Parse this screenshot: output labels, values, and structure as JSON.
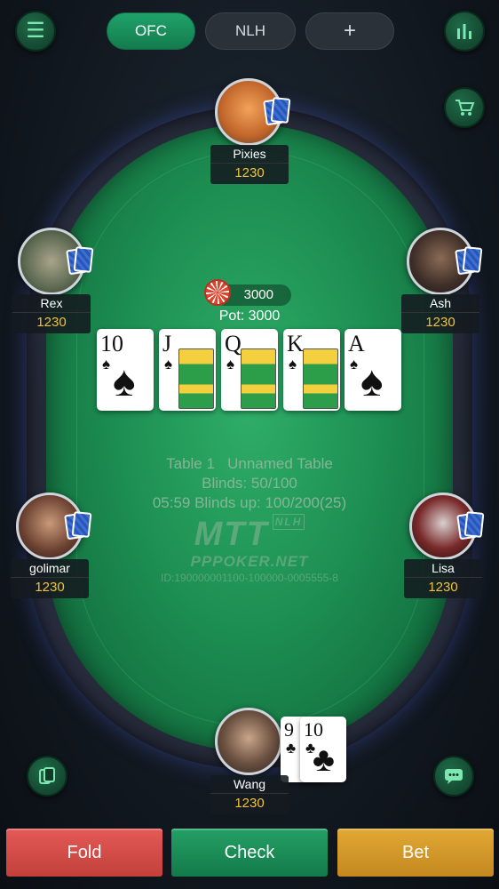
{
  "tabs": [
    "OFC",
    "NLH",
    "+"
  ],
  "icons": {
    "menu": "menu-icon",
    "stats": "bar-chart-icon",
    "shop": "cart-icon",
    "cards": "cards-icon",
    "chat": "chat-icon"
  },
  "players": {
    "top": {
      "name": "Pixies",
      "chips": "1230"
    },
    "left_upper": {
      "name": "Rex",
      "chips": "1230"
    },
    "right_upper": {
      "name": "Ash",
      "chips": "1230"
    },
    "left_lower": {
      "name": "golimar",
      "chips": "1230"
    },
    "right_lower": {
      "name": "Lisa",
      "chips": "1230"
    },
    "hero": {
      "name": "Wang",
      "chips": "1230"
    }
  },
  "pot": {
    "bet": "3000",
    "label": "Pot: 3000"
  },
  "community_cards": [
    {
      "rank": "10",
      "suit": "♠"
    },
    {
      "rank": "J",
      "suit": "♠"
    },
    {
      "rank": "Q",
      "suit": "♠"
    },
    {
      "rank": "K",
      "suit": "♠"
    },
    {
      "rank": "A",
      "suit": "♠"
    }
  ],
  "hero_cards": [
    {
      "rank": "9",
      "suit": "♣"
    },
    {
      "rank": "10",
      "suit": "♣"
    }
  ],
  "table_info": {
    "line1": "Table 1   Unnamed Table",
    "line2": "Blinds: 50/100",
    "line3": "05:59  Blinds up: 100/200(25)"
  },
  "watermark": {
    "logo": "MTT",
    "sub": "NLH",
    "site": "PPPOKER.NET",
    "id": "ID:190000001100-100000-0005555-8"
  },
  "actions": {
    "fold": "Fold",
    "check": "Check",
    "bet": "Bet"
  },
  "colors": {
    "fold": "#d9534f",
    "check": "#1d8f5a",
    "bet": "#d99a2b",
    "felt": "#1d8f52"
  }
}
